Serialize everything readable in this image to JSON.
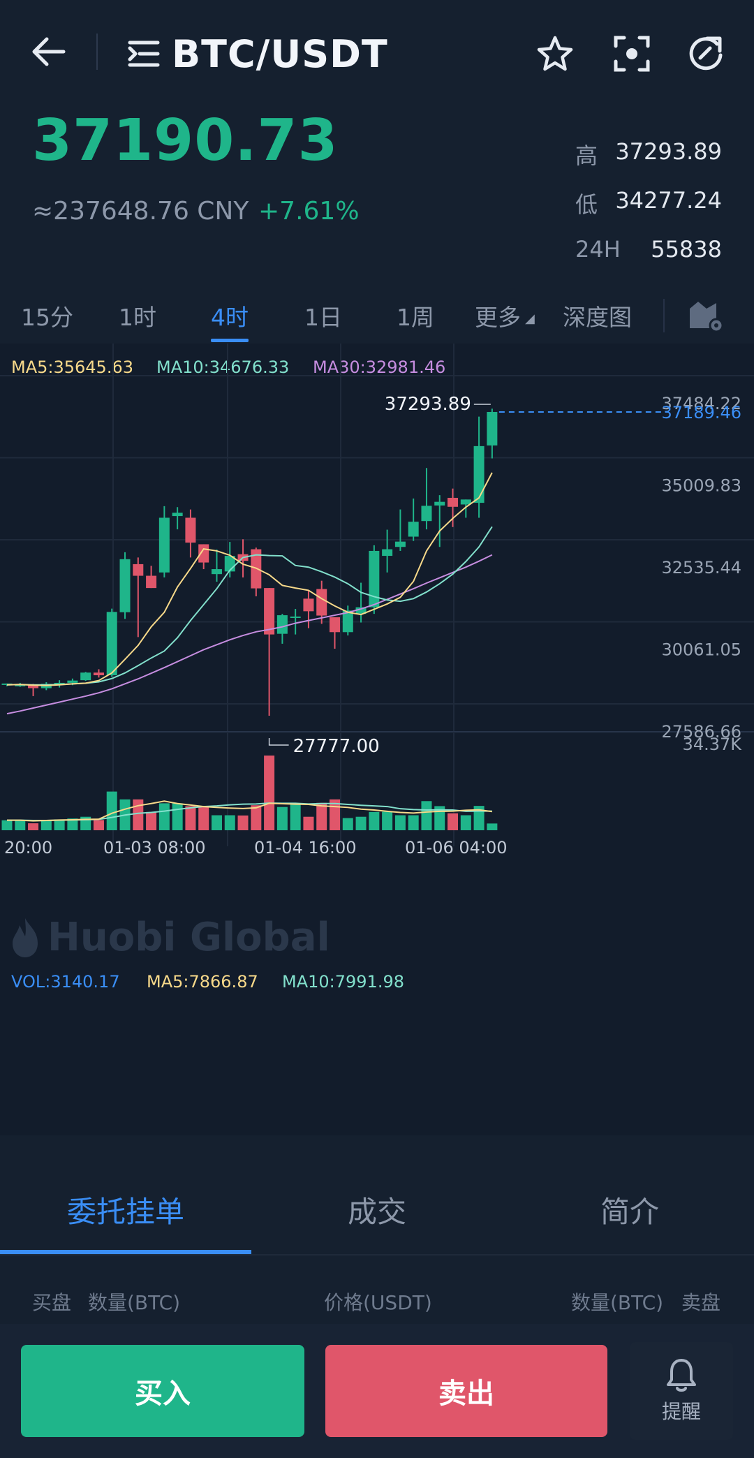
{
  "header": {
    "title": "BTC/USDT",
    "icons": [
      "back-arrow-icon",
      "menu-icon",
      "star-icon",
      "scan-icon",
      "refresh-icon"
    ]
  },
  "ticker": {
    "last_price": "37190.73",
    "cny_value": "≈237648.76 CNY",
    "change_pct": "+7.61%",
    "stats": [
      {
        "label": "高",
        "value": "37293.89"
      },
      {
        "label": "低",
        "value": "34277.24"
      },
      {
        "label": "24H",
        "value": "55838"
      }
    ]
  },
  "intervals": {
    "items": [
      "15分",
      "1时",
      "4时",
      "1日",
      "1周",
      "更多",
      "深度图"
    ],
    "active": "4时"
  },
  "indicators": {
    "ma5": "MA5:35645.63",
    "ma10": "MA10:34676.33",
    "ma30": "MA30:32981.46"
  },
  "watermark": "Huobi Global",
  "colors": {
    "up": "#1fb58a",
    "down": "#e0566a",
    "accent": "#3a8ef6",
    "ma5": "#f7d98a",
    "ma10": "#82e0cc",
    "ma30": "#c68de0"
  },
  "chart_data": {
    "type": "candlestick",
    "y_ticks": [
      "37484.22",
      "35009.83",
      "32535.44",
      "30061.05",
      "27586.66"
    ],
    "ylim": [
      27586.66,
      37484.22
    ],
    "high_label": "37293.89",
    "low_label": "27777.00",
    "current_price_label": "37189.46",
    "x_ticks": [
      "20:00",
      "01-03 08:00",
      "01-04 16:00",
      "01-06 04:00"
    ],
    "candles": [
      [
        28960,
        29000,
        28920,
        29000
      ],
      [
        28920,
        29020,
        28900,
        28960
      ],
      [
        28960,
        28990,
        28620,
        28860
      ],
      [
        28860,
        29040,
        28800,
        28990
      ],
      [
        28980,
        29100,
        28880,
        29020
      ],
      [
        29020,
        29150,
        28950,
        29090
      ],
      [
        29100,
        29350,
        29080,
        29330
      ],
      [
        29330,
        29430,
        29180,
        29250
      ],
      [
        29250,
        31260,
        29200,
        31160
      ],
      [
        31150,
        32960,
        30950,
        32750
      ],
      [
        32600,
        32800,
        30400,
        32250
      ],
      [
        32250,
        32550,
        31950,
        31880
      ],
      [
        32350,
        34350,
        32200,
        34000
      ],
      [
        34050,
        34320,
        33650,
        34150
      ],
      [
        34000,
        34250,
        32800,
        33250
      ],
      [
        33200,
        32550,
        32450,
        32650
      ],
      [
        32300,
        33040,
        32070,
        32450
      ],
      [
        32380,
        33270,
        32200,
        32850
      ],
      [
        32900,
        33350,
        32200,
        32700
      ],
      [
        33050,
        33100,
        31630,
        31870
      ],
      [
        31880,
        31840,
        28030,
        30480
      ],
      [
        30500,
        31100,
        30200,
        31060
      ],
      [
        30980,
        31250,
        30480,
        31020
      ],
      [
        31560,
        31800,
        30670,
        31180
      ],
      [
        31850,
        32100,
        30800,
        31050
      ],
      [
        31000,
        30850,
        30050,
        30550
      ],
      [
        30550,
        31350,
        30450,
        31200
      ],
      [
        31100,
        32040,
        30840,
        31300
      ],
      [
        31300,
        33170,
        31100,
        33000
      ],
      [
        32850,
        33640,
        32350,
        33050
      ],
      [
        33120,
        34250,
        33000,
        33280
      ],
      [
        33430,
        34580,
        33300,
        33880
      ],
      [
        33900,
        35500,
        33650,
        34360
      ],
      [
        34370,
        34680,
        33120,
        34480
      ],
      [
        34600,
        34880,
        33720,
        34330
      ],
      [
        34400,
        34400,
        34000,
        34550
      ],
      [
        34450,
        37050,
        34000,
        36160
      ],
      [
        36180,
        37290,
        35790,
        37190
      ]
    ],
    "ma5": [
      28960,
      28970,
      28950,
      28940,
      28960,
      28990,
      29010,
      29090,
      29320,
      29730,
      30150,
      30710,
      31150,
      31910,
      32470,
      33060,
      33000,
      32870,
      32600,
      32480,
      32280,
      31960,
      31880,
      31810,
      31560,
      31340,
      31150,
      31080,
      31240,
      31400,
      31600,
      32080,
      33000,
      33600,
      33980,
      34320,
      34600,
      35360
    ],
    "ma10": [
      28960,
      28970,
      28960,
      28960,
      28970,
      28990,
      29010,
      29050,
      29150,
      29320,
      29540,
      29770,
      29980,
      30380,
      30900,
      31380,
      31860,
      32420,
      32800,
      32880,
      32860,
      32850,
      32560,
      32510,
      32370,
      32210,
      32010,
      31750,
      31620,
      31520,
      31480,
      31560,
      31760,
      32010,
      32300,
      32680,
      33120,
      33730
    ],
    "ma30": [
      28090,
      28170,
      28260,
      28350,
      28440,
      28530,
      28620,
      28720,
      28840,
      28990,
      29140,
      29310,
      29480,
      29660,
      29840,
      30020,
      30170,
      30320,
      30450,
      30560,
      30630,
      30710,
      30820,
      30900,
      30980,
      31060,
      31140,
      31250,
      31380,
      31540,
      31700,
      31860,
      32030,
      32190,
      32350,
      32510,
      32690,
      32880
    ]
  },
  "volume": {
    "vol_label": "VOL:3140.17",
    "ma5_label": "MA5:7866.87",
    "ma10_label": "MA10:7991.98",
    "max_label": "34.37K",
    "values": [
      4.6,
      4.6,
      3.2,
      4.5,
      5,
      5.4,
      6.2,
      4.7,
      17.8,
      14.2,
      14.2,
      8.4,
      12.4,
      12.4,
      11.1,
      11.2,
      6.9,
      6.9,
      6.8,
      11.5,
      34.37,
      10.7,
      12,
      6.2,
      12.6,
      14.2,
      5.6,
      6.2,
      8.4,
      8.5,
      6.9,
      6.9,
      13.4,
      11.1,
      7.8,
      6.9,
      11.2,
      3.1
    ],
    "ma5": [
      4.6,
      4.6,
      4.3,
      4.5,
      4.7,
      4.8,
      5,
      5.1,
      7.8,
      9.7,
      11.3,
      12.3,
      13.4,
      12.3,
      11.6,
      10.9,
      10.5,
      10.2,
      10,
      10.3,
      12.4,
      12.2,
      12,
      11.9,
      11.2,
      10.9,
      10.5,
      9.7,
      9.3,
      8.7,
      8.2,
      7.9,
      8.4,
      8.7,
      8.8,
      9.2,
      9.4,
      8.6
    ],
    "ma10": [
      4.6,
      4.6,
      4.5,
      4.5,
      4.6,
      4.7,
      4.8,
      5,
      5.9,
      7,
      7.8,
      8.2,
      8.8,
      9.6,
      10.3,
      10.9,
      11.2,
      11.7,
      12,
      12.1,
      12.5,
      12.4,
      12.4,
      12.1,
      12.3,
      12.3,
      11.9,
      11.5,
      11.2,
      10.9,
      9.9,
      9.5,
      9.3,
      9.4,
      9.3,
      8.7,
      8.8,
      8.8
    ]
  },
  "panel": {
    "tabs": [
      "委托挂单",
      "成交",
      "简介"
    ],
    "active_tab": "委托挂单",
    "columns": {
      "buy": "买盘",
      "qty_left": "数量(BTC)",
      "price": "价格(USDT)",
      "qty_right": "数量(BTC)",
      "sell": "卖盘"
    }
  },
  "actions": {
    "buy": "买入",
    "sell": "卖出",
    "alert": "提醒"
  }
}
